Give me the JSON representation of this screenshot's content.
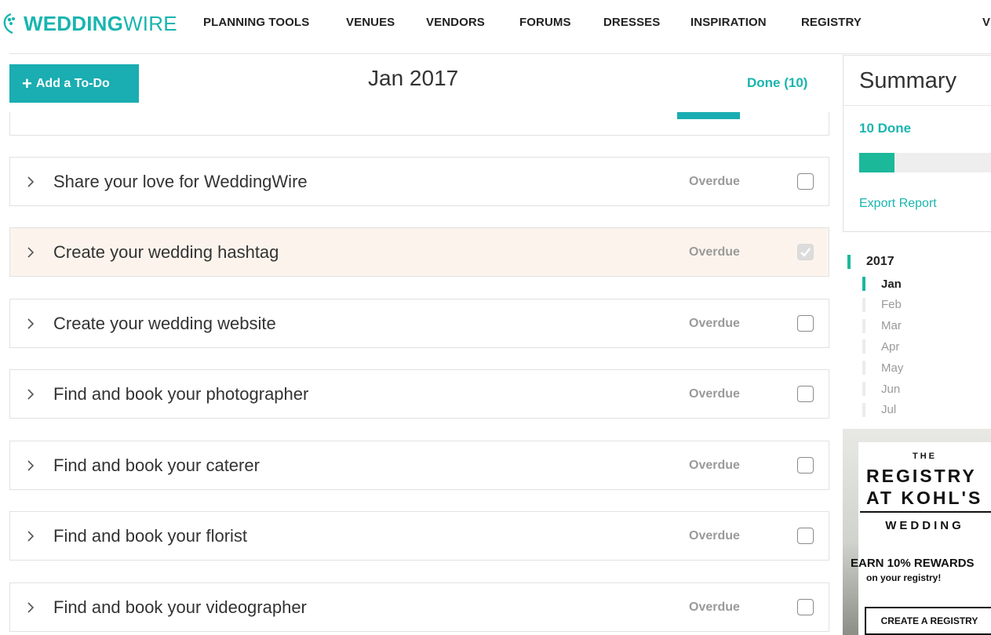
{
  "brand": {
    "name_bold": "WEDDING",
    "name_light": "WIRE",
    "color": "#19b5b0"
  },
  "nav": {
    "items": [
      "PLANNING TOOLS",
      "VENUES",
      "VENDORS",
      "FORUMS",
      "DRESSES",
      "INSPIRATION",
      "REGISTRY",
      "V"
    ]
  },
  "toolbar": {
    "add_label": "Add a To-Do",
    "add_icon": "plus-icon",
    "month_title": "Jan 2017",
    "done_link": "Done (10)",
    "accent": "#1aadb1"
  },
  "tasks": [
    {
      "title": "Share your love for WeddingWire",
      "status": "Overdue",
      "checked": false,
      "highlight": false
    },
    {
      "title": "Create your wedding hashtag",
      "status": "Overdue",
      "checked": true,
      "highlight": true
    },
    {
      "title": "Create your wedding website",
      "status": "Overdue",
      "checked": false,
      "highlight": false
    },
    {
      "title": "Find and book your photographer",
      "status": "Overdue",
      "checked": false,
      "highlight": false
    },
    {
      "title": "Find and book your caterer",
      "status": "Overdue",
      "checked": false,
      "highlight": false
    },
    {
      "title": "Find and book your florist",
      "status": "Overdue",
      "checked": false,
      "highlight": false
    },
    {
      "title": "Find and book your videographer",
      "status": "Overdue",
      "checked": false,
      "highlight": false
    }
  ],
  "summary": {
    "title": "Summary",
    "done_text": "10 Done",
    "progress_fraction": 0.25,
    "progress_color": "#1cb89a",
    "export_label": "Export Report"
  },
  "timeline": {
    "year": "2017",
    "months": [
      "Jan",
      "Feb",
      "Mar",
      "Apr",
      "May",
      "Jun",
      "Jul"
    ],
    "active_month": "Jan"
  },
  "ad": {
    "the": "THE",
    "line1": "REGISTRY",
    "line2": "AT KOHL'S",
    "line3": "WEDDING",
    "earn": "EARN 10% REWARDS",
    "sub": "on your registry!",
    "cta": "CREATE A REGISTRY"
  }
}
